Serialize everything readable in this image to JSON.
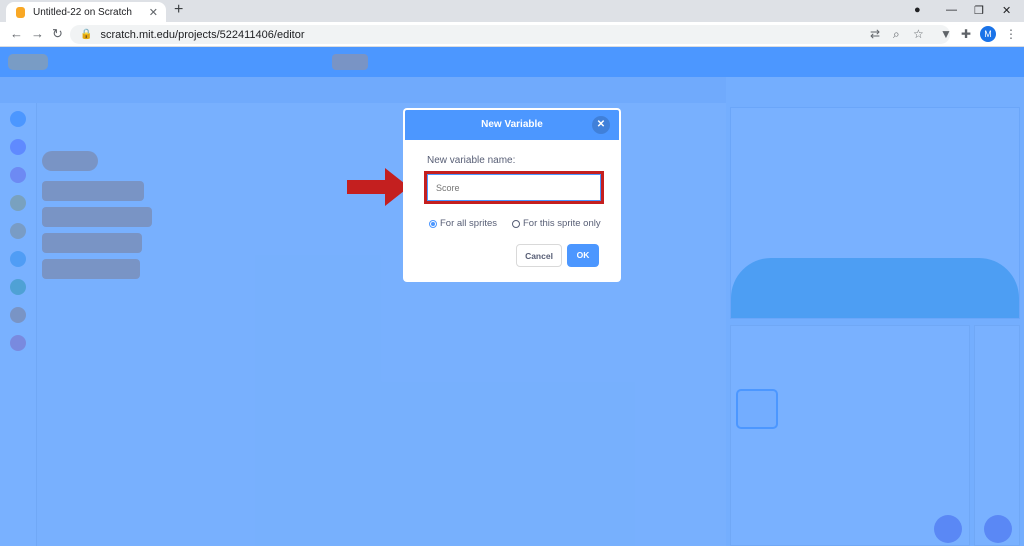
{
  "browser": {
    "tab_title": "Untitled-22 on Scratch",
    "tab_close": "✕",
    "new_tab": "+",
    "url": "scratch.mit.edu/projects/522411406/editor",
    "profile_initial": "M"
  },
  "dialog": {
    "title": "New Variable",
    "close": "✕",
    "name_label": "New variable name:",
    "input_value": "Score",
    "option_all": "For all sprites",
    "option_this": "For this sprite only",
    "selected_option": "For all sprites",
    "cancel_label": "Cancel",
    "ok_label": "OK"
  },
  "colors": {
    "scratch_blue": "#4c97ff",
    "highlight_red": "#c41f1f",
    "overlay": "rgba(76,151,255,0.75)"
  }
}
